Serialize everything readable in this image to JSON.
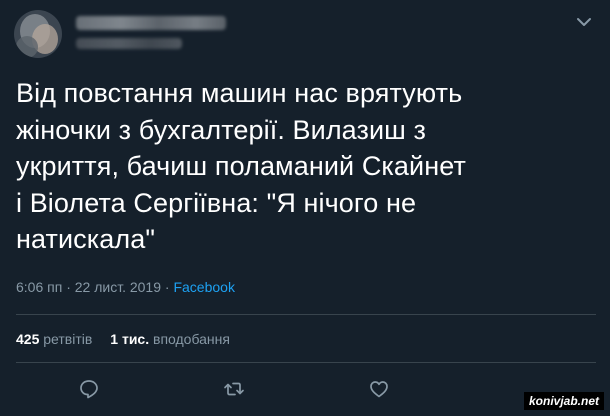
{
  "tweet": {
    "text": "Від повстання машин нас врятують\nжiночки з бухгалтерії. Вилазиш з\nукриття, бачиш поламаний Скайнет\nі Віолета Сергіївна: \"Я нічого не\nнатискала\"",
    "time": "6:06 пп",
    "separator1": " · ",
    "date": "22 лист. 2019",
    "separator2": " · ",
    "source": "Facebook"
  },
  "stats": {
    "retweets_count": "425",
    "retweets_label": "ретвітів",
    "likes_count": "1 тис.",
    "likes_label": "вподобання"
  },
  "watermark": "konivjab.net",
  "colors": {
    "background": "#15202b",
    "text": "#ffffff",
    "secondary": "#8899a6",
    "link": "#1da1f2",
    "divider": "#38444d"
  },
  "icons": {
    "caret": "chevron-down-icon",
    "reply": "speech-bubble-icon",
    "retweet": "retweet-icon",
    "like": "heart-icon"
  }
}
